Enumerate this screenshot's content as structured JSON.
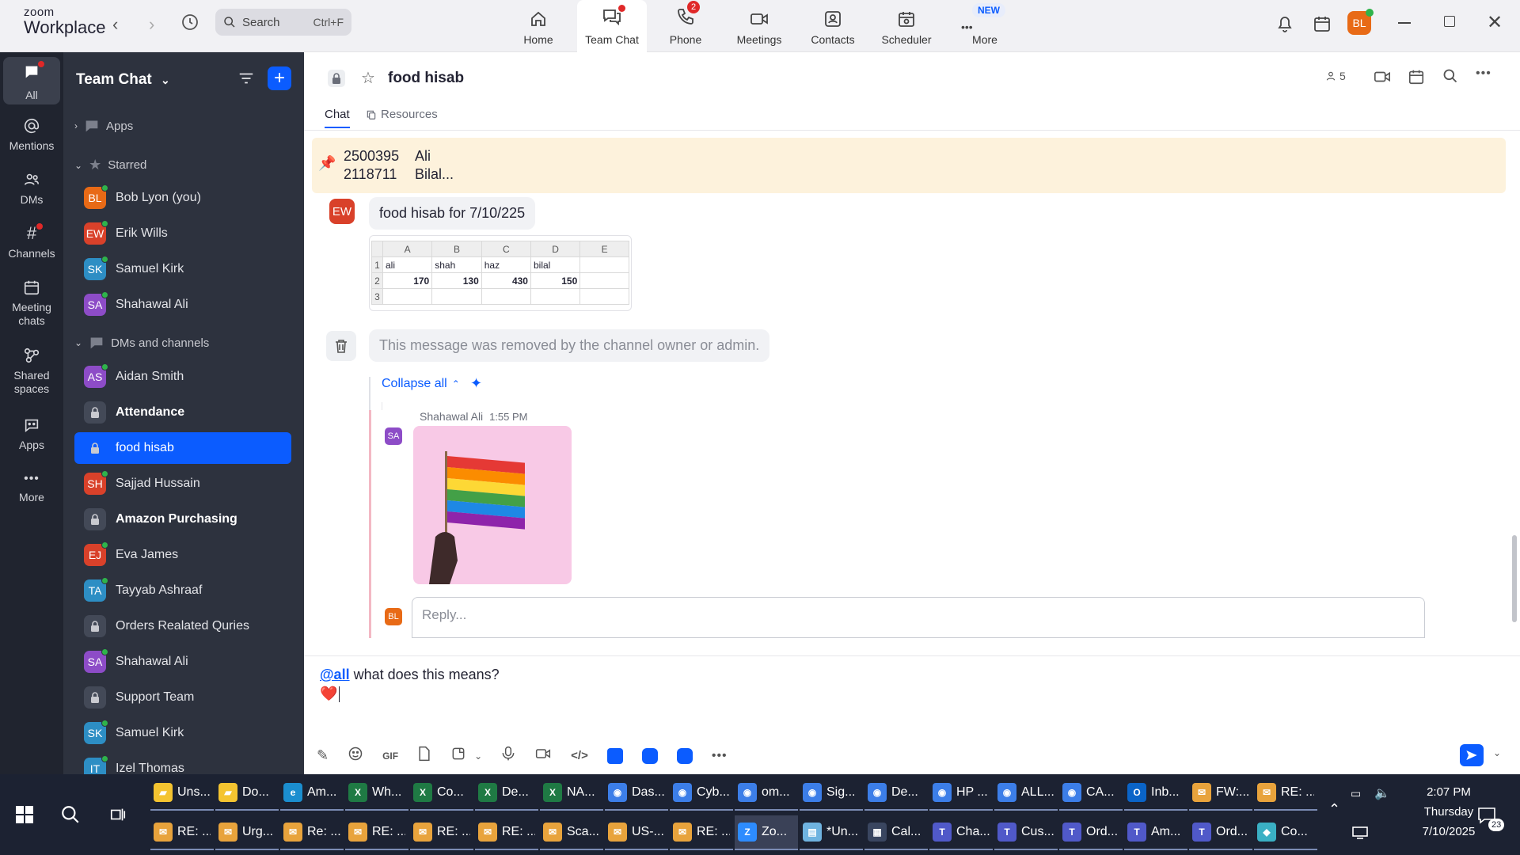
{
  "app": {
    "logo_line1": "zoom",
    "logo_line2": "Workplace"
  },
  "search": {
    "placeholder": "Search",
    "shortcut": "Ctrl+F"
  },
  "tabs": [
    {
      "label": "Home"
    },
    {
      "label": "Team Chat"
    },
    {
      "label": "Phone",
      "badge": "2"
    },
    {
      "label": "Meetings"
    },
    {
      "label": "Contacts"
    },
    {
      "label": "Scheduler"
    },
    {
      "label": "More",
      "badge": "NEW"
    }
  ],
  "user": {
    "initials": "BL"
  },
  "rail": [
    {
      "label": "All"
    },
    {
      "label": "Mentions"
    },
    {
      "label": "DMs"
    },
    {
      "label": "Channels"
    },
    {
      "label": "Meeting chats"
    },
    {
      "label": "Shared spaces"
    },
    {
      "label": "Apps"
    },
    {
      "label": "More"
    }
  ],
  "sidebar": {
    "title": "Team Chat",
    "sections": {
      "apps": "Apps",
      "starred": "Starred",
      "dms": "DMs and channels"
    },
    "starred": [
      {
        "initials": "BL",
        "name": "Bob Lyon (you)",
        "color": "#e86a16"
      },
      {
        "initials": "EW",
        "name": "Erik Wills",
        "color": "#d9412a"
      },
      {
        "initials": "SK",
        "name": "Samuel Kirk",
        "color": "#2d8ec4"
      },
      {
        "initials": "SA",
        "name": "Shahawal Ali",
        "color": "#8d4cc7"
      }
    ],
    "dms": [
      {
        "initials": "AS",
        "name": "Aidan Smith",
        "color": "#8d4cc7"
      },
      {
        "lock": true,
        "name": "Attendance",
        "bold": true
      },
      {
        "lock": true,
        "name": "food hisab",
        "selected": true
      },
      {
        "initials": "SH",
        "name": "Sajjad Hussain",
        "color": "#d9412a"
      },
      {
        "lock": true,
        "name": "Amazon Purchasing",
        "bold": true
      },
      {
        "initials": "EJ",
        "name": "Eva James",
        "color": "#d9412a"
      },
      {
        "initials": "TA",
        "name": "Tayyab Ashraaf",
        "color": "#2d8ec4"
      },
      {
        "lock": true,
        "name": "Orders Realated Quries"
      },
      {
        "initials": "SA",
        "name": "Shahawal Ali",
        "color": "#8d4cc7"
      },
      {
        "lock": true,
        "name": "Support Team"
      },
      {
        "initials": "SK",
        "name": "Samuel Kirk",
        "color": "#2d8ec4"
      },
      {
        "initials": "IT",
        "name": "Izel Thomas",
        "color": "#2d8ec4"
      }
    ]
  },
  "channel": {
    "name": "food hisab",
    "member_count": "5",
    "subtabs": {
      "chat": "Chat",
      "resources": "Resources"
    }
  },
  "pinned": {
    "line1_num": "2500395",
    "line1_name": "Ali",
    "line2_num": "2118711",
    "line2_name": "Bilal..."
  },
  "messages": {
    "ew_initials": "EW",
    "ew_text": "food hisab for 7/10/225",
    "sheet": {
      "cols": [
        "A",
        "B",
        "C",
        "D",
        "E"
      ],
      "rows": [
        [
          "1",
          "ali",
          "shah",
          "haz",
          "bilal",
          ""
        ],
        [
          "2",
          "170",
          "130",
          "430",
          "150",
          ""
        ],
        [
          "3",
          "",
          "",
          "",
          "",
          ""
        ]
      ]
    },
    "removed_text": "This message was removed by the channel owner or admin.",
    "collapse_label": "Collapse all",
    "reply_author": "Shahawal Ali",
    "reply_time": "1:55 PM",
    "reply_initials": "SA",
    "reply_placeholder": "Reply...",
    "me_initials": "BL"
  },
  "composer": {
    "mention": "@all",
    "text": " what does this means?",
    "emoji": "❤️"
  },
  "taskbar": {
    "row1": [
      {
        "label": "Uns...",
        "icon": "folder",
        "color": "#f4c430"
      },
      {
        "label": "Do...",
        "icon": "folder",
        "color": "#f4c430"
      },
      {
        "label": "Am...",
        "icon": "edge",
        "color": "#1b8ecf"
      },
      {
        "label": "Wh...",
        "icon": "X",
        "color": "#1f7a44"
      },
      {
        "label": "Co...",
        "icon": "X",
        "color": "#1f7a44"
      },
      {
        "label": "De...",
        "icon": "X",
        "color": "#1f7a44"
      },
      {
        "label": "NA...",
        "icon": "X",
        "color": "#1f7a44"
      },
      {
        "label": "Das...",
        "icon": "chrome",
        "color": "#3c7ee8"
      },
      {
        "label": "Cyb...",
        "icon": "chrome",
        "color": "#3c7ee8"
      },
      {
        "label": "om...",
        "icon": "chrome",
        "color": "#3c7ee8"
      },
      {
        "label": "Sig...",
        "icon": "chrome",
        "color": "#3c7ee8"
      },
      {
        "label": "De...",
        "icon": "chrome",
        "color": "#3c7ee8"
      },
      {
        "label": "HP ...",
        "icon": "chrome",
        "color": "#3c7ee8"
      },
      {
        "label": "ALL...",
        "icon": "chrome",
        "color": "#3c7ee8"
      },
      {
        "label": "CA...",
        "icon": "chrome",
        "color": "#3c7ee8"
      },
      {
        "label": "Inb...",
        "icon": "O",
        "color": "#0a64c8"
      },
      {
        "label": "FW:...",
        "icon": "mail",
        "color": "#e8a33c"
      },
      {
        "label": "RE: ...",
        "icon": "mail",
        "color": "#e8a33c"
      }
    ],
    "row2": [
      {
        "label": "RE: ...",
        "icon": "mail",
        "color": "#e8a33c"
      },
      {
        "label": "Urg...",
        "icon": "mail",
        "color": "#e8a33c"
      },
      {
        "label": "Re: ...",
        "icon": "mail",
        "color": "#e8a33c"
      },
      {
        "label": "RE: ...",
        "icon": "mail",
        "color": "#e8a33c"
      },
      {
        "label": "RE: ...",
        "icon": "mail",
        "color": "#e8a33c"
      },
      {
        "label": "RE: ...",
        "icon": "mail",
        "color": "#e8a33c"
      },
      {
        "label": "Sca...",
        "icon": "mail",
        "color": "#e8a33c"
      },
      {
        "label": "US-...",
        "icon": "mail",
        "color": "#e8a33c"
      },
      {
        "label": "RE: ...",
        "icon": "mail",
        "color": "#e8a33c"
      },
      {
        "label": "Zo...",
        "icon": "zoom",
        "color": "#2d8cff",
        "active": true
      },
      {
        "label": "*Un...",
        "icon": "notepad",
        "color": "#6fb3e0"
      },
      {
        "label": "Cal...",
        "icon": "calc",
        "color": "#3a4660"
      },
      {
        "label": "Cha...",
        "icon": "T",
        "color": "#5059c9"
      },
      {
        "label": "Cus...",
        "icon": "T",
        "color": "#5059c9"
      },
      {
        "label": "Ord...",
        "icon": "T",
        "color": "#5059c9"
      },
      {
        "label": "Am...",
        "icon": "T",
        "color": "#5059c9"
      },
      {
        "label": "Ord...",
        "icon": "T",
        "color": "#5059c9"
      },
      {
        "label": "Co...",
        "icon": "diamond",
        "color": "#3ab0c4"
      }
    ],
    "time": "2:07 PM",
    "day": "Thursday",
    "date": "7/10/2025",
    "notif_count": "23"
  }
}
